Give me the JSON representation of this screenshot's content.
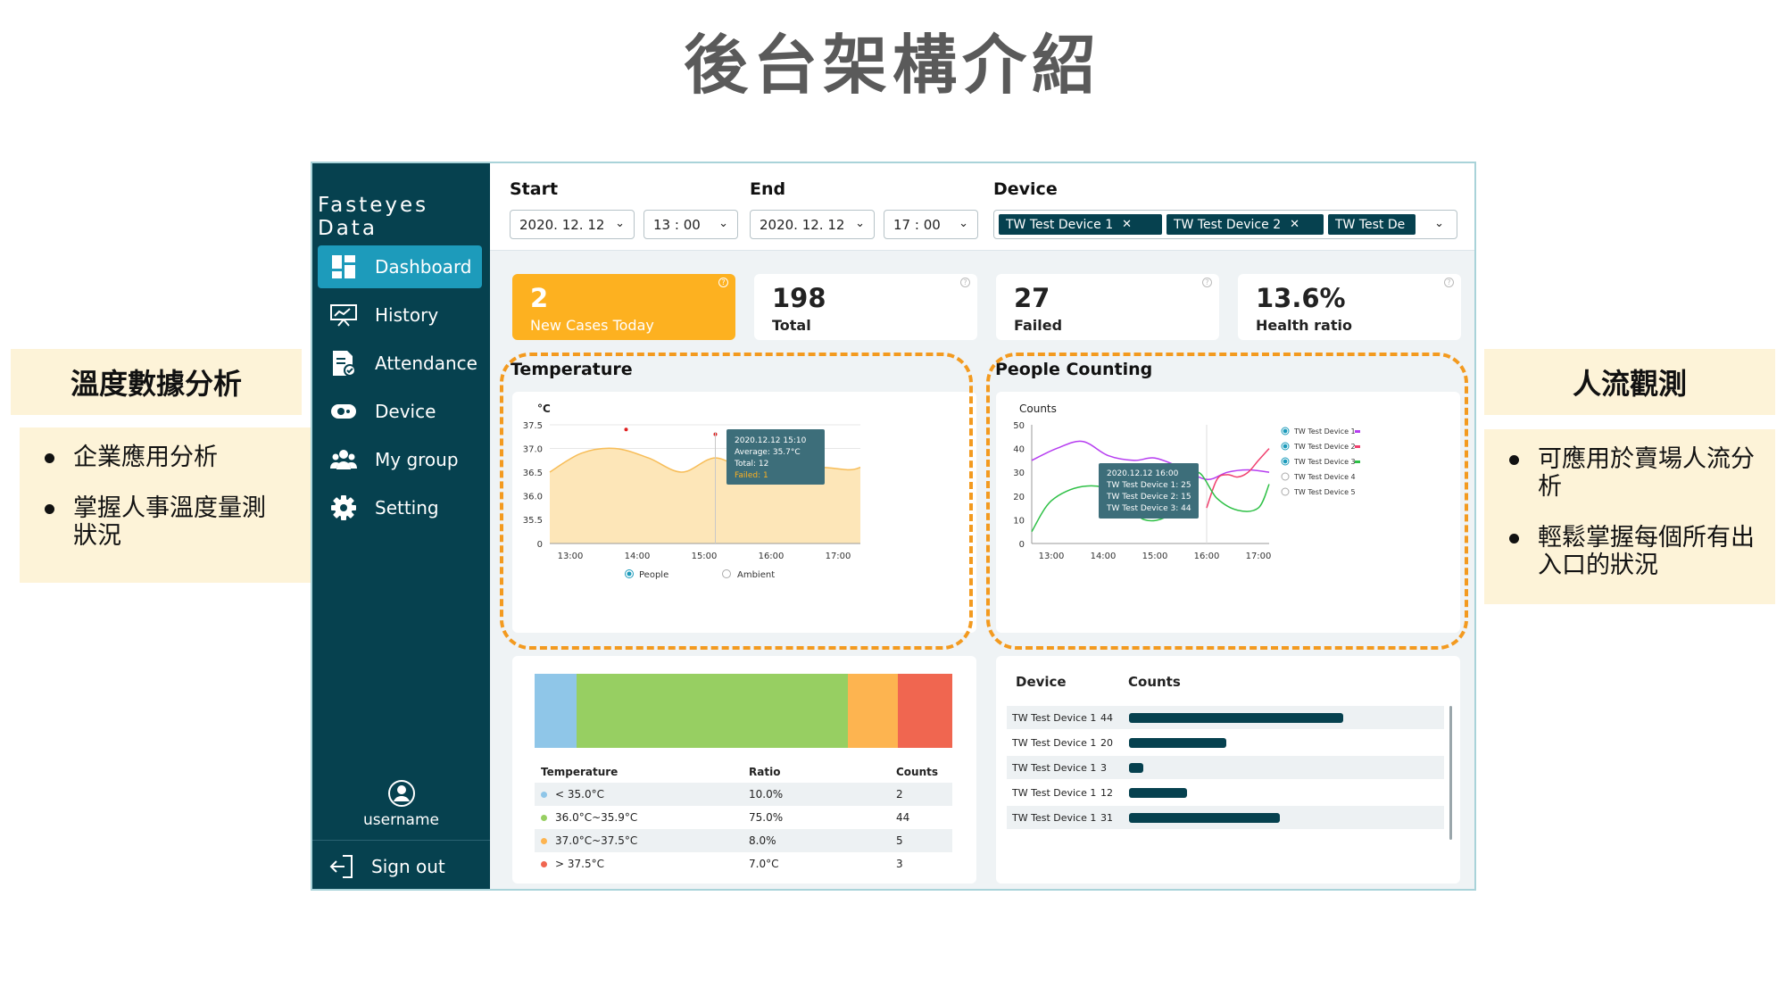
{
  "slide": {
    "title": "後台架構介紹",
    "left_heading": "溫度數據分析",
    "left_bullets": [
      "企業應用分析",
      "掌握人事溫度量測狀況"
    ],
    "right_heading": "人流觀測",
    "right_bullets": [
      "可應用於賣場人流分析",
      "輕鬆掌握每個所有出入口的狀況"
    ]
  },
  "app": {
    "logo": "Fasteyes Data",
    "nav": [
      {
        "label": "Dashboard",
        "icon": "dashboard-icon",
        "active": true
      },
      {
        "label": "History",
        "icon": "history-icon"
      },
      {
        "label": "Attendance",
        "icon": "attendance-icon"
      },
      {
        "label": "Device",
        "icon": "device-icon"
      },
      {
        "label": "My group",
        "icon": "group-icon"
      },
      {
        "label": "Setting",
        "icon": "gear-icon"
      }
    ],
    "username": "username",
    "signout": "Sign out"
  },
  "filters": {
    "start_label": "Start",
    "start_date": "2020. 12. 12",
    "start_hour": "13",
    "start_min": "00",
    "end_label": "End",
    "end_date": "2020. 12. 12",
    "end_hour": "17",
    "end_min": "00",
    "device_label": "Device",
    "devices": [
      "TW Test Device 1",
      "TW Test Device 2",
      "TW Test De"
    ]
  },
  "stats": [
    {
      "value": "2",
      "label": "New Cases Today",
      "color": "#fdb120"
    },
    {
      "value": "198",
      "label": "Total"
    },
    {
      "value": "27",
      "label": "Failed"
    },
    {
      "value": "13.6%",
      "label": "Health ratio"
    }
  ],
  "temperature": {
    "section_title": "Temperature",
    "unit": "°C",
    "tooltip": {
      "time": "2020.12.12  15:10",
      "average": "Average: 35.7°C",
      "total": "Total: 12",
      "failed": "Failed: 1"
    },
    "legend": [
      "People",
      "Ambient"
    ]
  },
  "people_counting": {
    "section_title": "People Counting",
    "ylabel": "Counts",
    "tooltip": {
      "time": "2020.12.12  16:00",
      "lines": [
        "TW Test Device 1: 25",
        "TW Test Device 2: 15",
        "TW Test Device 3: 44"
      ]
    },
    "legend": [
      {
        "name": "TW Test Device 1",
        "color": "#b63df0",
        "selected": true
      },
      {
        "name": "TW Test Device 2",
        "color": "#f0406e",
        "selected": true
      },
      {
        "name": "TW Test Device 3",
        "color": "#2ec046",
        "selected": true
      },
      {
        "name": "TW Test Device 4",
        "color": "#cccccc",
        "selected": false
      },
      {
        "name": "TW Test Device 5",
        "color": "#cccccc",
        "selected": false
      }
    ]
  },
  "temp_table": {
    "headers": [
      "Temperature",
      "Ratio",
      "Counts"
    ],
    "rows": [
      {
        "range": "< 35.0°C",
        "ratio": "10.0%",
        "counts": "2",
        "color": "#8fc6e8"
      },
      {
        "range": "36.0°C~35.9°C",
        "ratio": "75.0%",
        "counts": "44",
        "color": "#97cf62"
      },
      {
        "range": "37.0°C~37.5°C",
        "ratio": "8.0%",
        "counts": "5",
        "color": "#fdb450"
      },
      {
        "range": "> 37.5°C",
        "ratio": "7.0°C",
        "counts": "3",
        "color": "#f06650"
      }
    ]
  },
  "device_table": {
    "headers": [
      "Device",
      "Counts"
    ],
    "rows": [
      {
        "device": "TW Test Device 1",
        "counts": "44",
        "bar": 44
      },
      {
        "device": "TW Test Device 1",
        "counts": "20",
        "bar": 20
      },
      {
        "device": "TW Test Device 1",
        "counts": "3",
        "bar": 3
      },
      {
        "device": "TW Test Device 1",
        "counts": "12",
        "bar": 12
      },
      {
        "device": "TW Test Device 1",
        "counts": "31",
        "bar": 31
      }
    ]
  },
  "chart_data": [
    {
      "type": "area",
      "title": "Temperature",
      "ylabel": "°C",
      "ylim": [
        0,
        37.5
      ],
      "yticks": [
        "37.5",
        "37.0",
        "36.5",
        "36.0",
        "35.5",
        "0"
      ],
      "xticks": [
        "13:00",
        "14:00",
        "15:00",
        "16:00",
        "17:00"
      ],
      "series": [
        {
          "name": "People",
          "x": [
            "12:40",
            "13:10",
            "13:40",
            "14:10",
            "14:40",
            "15:10",
            "15:40",
            "16:10",
            "16:40",
            "17:10",
            "17:20"
          ],
          "values": [
            36.5,
            36.9,
            37.0,
            36.8,
            36.5,
            36.8,
            36.5,
            36.45,
            36.6,
            36.55,
            36.6
          ]
        }
      ],
      "points": [
        {
          "x": "13:50",
          "y": 37.4
        },
        {
          "x": "15:10",
          "y": 37.3
        }
      ],
      "legend": [
        "People",
        "Ambient"
      ]
    },
    {
      "type": "line",
      "title": "People Counting",
      "ylabel": "Counts",
      "ylim": [
        0,
        50
      ],
      "yticks": [
        "50",
        "40",
        "30",
        "20",
        "10",
        "0"
      ],
      "xticks": [
        "13:00",
        "14:00",
        "15:00",
        "16:00",
        "17:00"
      ],
      "series": [
        {
          "name": "TW Test Device 1",
          "x": [
            12.6,
            13.1,
            13.6,
            14.1,
            14.6,
            15.0,
            15.5,
            16.0,
            16.4,
            16.8,
            17.3
          ],
          "values": [
            35,
            40,
            43,
            37,
            35,
            36,
            32,
            27,
            30,
            31,
            30
          ]
        },
        {
          "name": "TW Test Device 2",
          "x": [
            16.0,
            16.2,
            16.4,
            16.6,
            16.8,
            17.0,
            17.3
          ],
          "values": [
            15,
            27,
            29,
            28,
            30,
            35,
            40
          ]
        },
        {
          "name": "TW Test Device 3",
          "x": [
            12.6,
            13.0,
            13.6,
            14.2,
            14.8,
            15.4,
            15.8,
            16.2,
            16.6,
            17.0,
            17.3
          ],
          "values": [
            5,
            18,
            24,
            22,
            10,
            14,
            30,
            19,
            14,
            15,
            25
          ]
        }
      ]
    }
  ]
}
